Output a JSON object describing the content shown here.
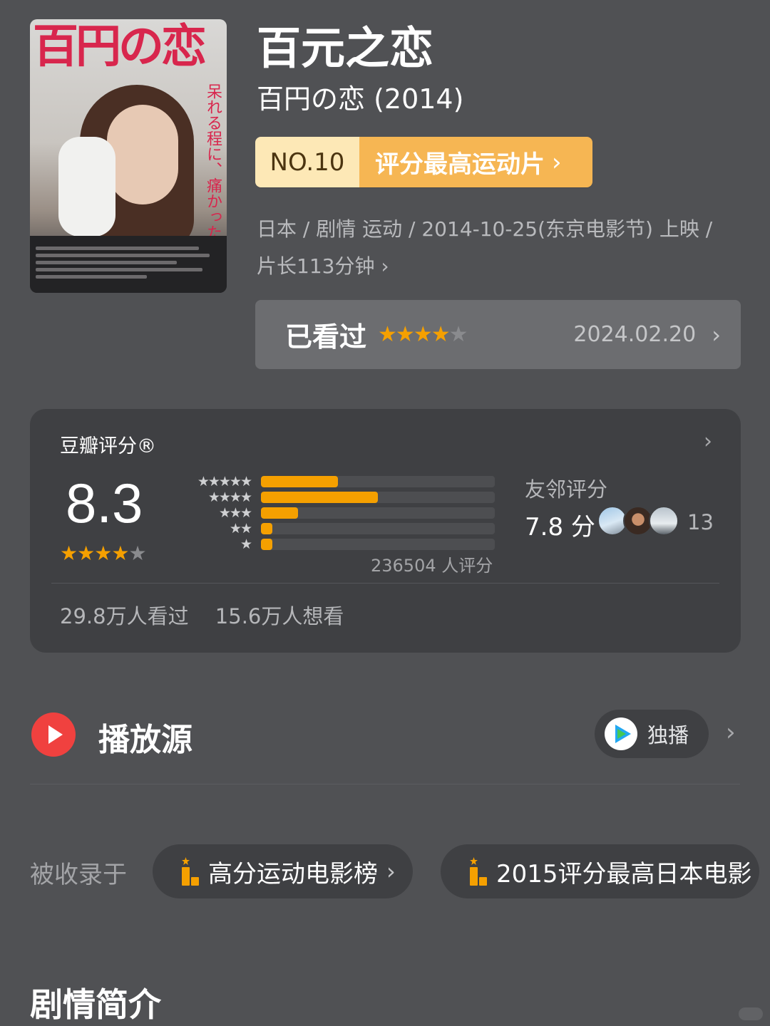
{
  "movie": {
    "title": "百元之恋",
    "original_title": "百円の恋 (2014)",
    "poster_title": "百円の恋",
    "poster_tagline": "呆れる程に、痛かった。",
    "rank": {
      "number": "NO.10",
      "label": "评分最高运动片",
      "chevron": "›"
    },
    "meta_line1": "日本 / 剧情 运动 / 2014-10-25(东京电影节) 上映 /",
    "meta_line2": "片长113分钟 ›"
  },
  "watched": {
    "label": "已看过",
    "stars": 4,
    "max_stars": 5,
    "date": "2024.02.20",
    "chevron": "›"
  },
  "rating": {
    "title": "豆瓣评分®",
    "chevron": "›",
    "score": "8.3",
    "stars": 4,
    "distribution": [
      {
        "stars": "★★★★★",
        "fraction": 0.33
      },
      {
        "stars": "★★★★",
        "fraction": 0.5
      },
      {
        "stars": "★★★",
        "fraction": 0.16
      },
      {
        "stars": "★★",
        "fraction": 0.05
      },
      {
        "stars": "★",
        "fraction": 0.05
      }
    ],
    "count_text": "236504 人评分",
    "friends": {
      "label": "友邻评分",
      "score": "7.8 分",
      "count": "13"
    },
    "watched_count": "29.8万人看过",
    "want_count": "15.6万人想看"
  },
  "play": {
    "title": "播放源",
    "exclusive_label": "独播",
    "chevron": "›"
  },
  "collected": {
    "label": "被收录于",
    "lists": [
      {
        "label": "高分运动电影榜",
        "chevron": "›"
      },
      {
        "label": "2015评分最高日本电影",
        "chevron": ""
      }
    ]
  },
  "synopsis": {
    "title": "剧情简介"
  },
  "colors": {
    "background": "#505154",
    "card": "#3f4043",
    "star": "#f5a000",
    "rank_light": "#fde8b6",
    "rank_dark": "#f6b653",
    "play_red": "#f0413f"
  },
  "icons": [
    "play-source-icon",
    "tencent-video-icon",
    "podium-icon",
    "chevron-right-icon",
    "star-icon"
  ]
}
